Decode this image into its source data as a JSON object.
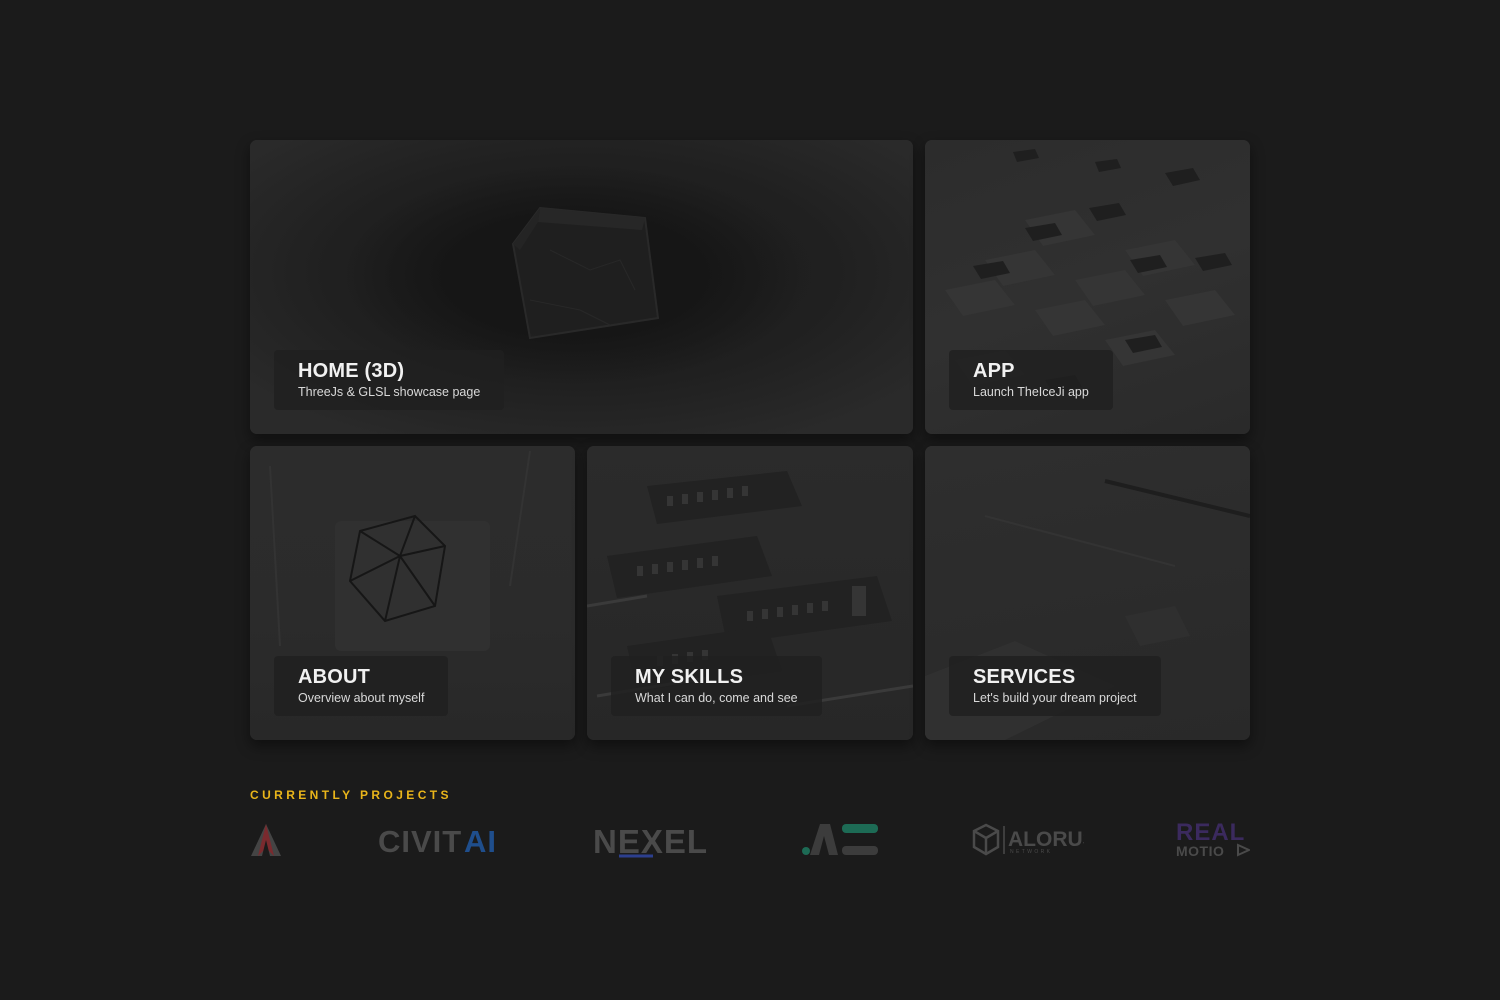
{
  "cards": {
    "home": {
      "title": "HOME (3D)",
      "subtitle": "ThreeJs & GLSL showcase page"
    },
    "app": {
      "title": "APP",
      "subtitle": "Launch TheIceJi app"
    },
    "about": {
      "title": "ABOUT",
      "subtitle": "Overview about myself"
    },
    "skills": {
      "title": "MY SKILLS",
      "subtitle": "What I can do, come and see"
    },
    "services": {
      "title": "SERVICES",
      "subtitle": "Let's build your dream project"
    }
  },
  "projects": {
    "heading": "CURRENTLY PROJECTS",
    "logos": [
      {
        "icon": "triangle-a-logo"
      },
      {
        "text_a": "CIVIT",
        "text_b": "AI",
        "icon": "civitai-logo"
      },
      {
        "text": "NEXEL",
        "icon": "nexel-logo"
      },
      {
        "icon": "ae-logo"
      },
      {
        "text": "ALORUS",
        "small": "NETWORK",
        "icon": "alorus-logo"
      },
      {
        "text_a": "REAL",
        "text_b": "MOTIO",
        "icon": "real-motion-logo"
      }
    ]
  },
  "colors": {
    "background": "#1b1b1b",
    "accent": "#e9b51a",
    "civitai_blue": "#1f4e8c",
    "nexel_blue": "#2c3f8e",
    "ae_green": "#1d6b55",
    "real_purple": "#3b2a5e",
    "triangle_red": "#7a2a2e"
  }
}
